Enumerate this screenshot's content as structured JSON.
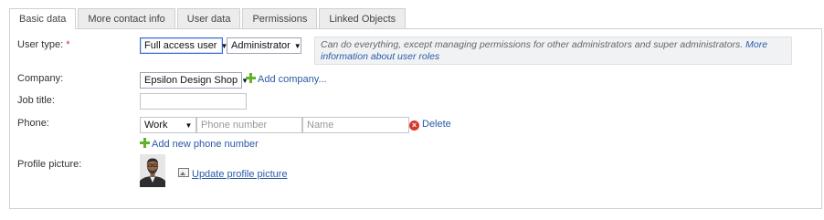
{
  "tabs": [
    {
      "label": "Basic data",
      "active": true
    },
    {
      "label": "More contact info",
      "active": false
    },
    {
      "label": "User data",
      "active": false
    },
    {
      "label": "Permissions",
      "active": false
    },
    {
      "label": "Linked Objects",
      "active": false
    }
  ],
  "form": {
    "user_type": {
      "label": "User type:",
      "required_mark": "*",
      "access_value": "Full access user",
      "role_value": "Administrator",
      "hint_text": "Can do everything, except managing permissions for other administrators and super administrators.",
      "hint_link": "More information about user roles"
    },
    "company": {
      "label": "Company:",
      "value": "Epsilon Design Shop",
      "add_label": "Add company..."
    },
    "job_title": {
      "label": "Job title:",
      "value": ""
    },
    "phone": {
      "label": "Phone:",
      "type_value": "Work",
      "number_placeholder": "Phone number",
      "name_placeholder": "Name",
      "delete_label": "Delete",
      "add_label": "Add new phone number"
    },
    "profile_picture": {
      "label": "Profile picture:",
      "update_label": "Update profile picture"
    }
  },
  "colors": {
    "accent_link": "#2a5aa8",
    "add_icon": "#62b22c",
    "delete_icon": "#d9372b",
    "required": "#d32f2f"
  },
  "icons": {
    "add": "plus-icon",
    "delete": "delete-circle-icon",
    "image": "image-icon",
    "dropdown": "caret-down-icon"
  }
}
